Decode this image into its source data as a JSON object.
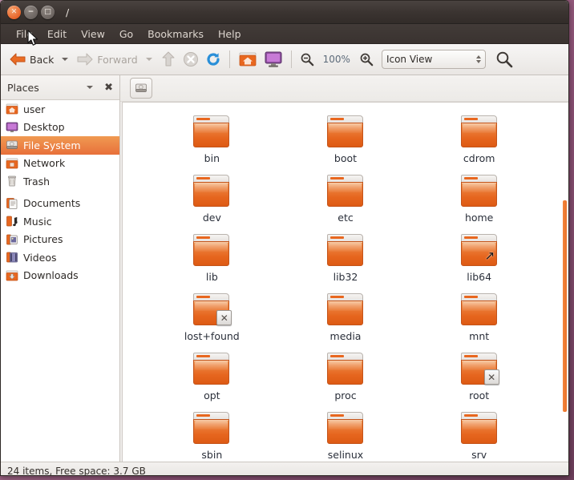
{
  "window": {
    "title": "/",
    "controls": [
      {
        "name": "close",
        "glyph": "✕"
      },
      {
        "name": "minimize",
        "glyph": "−"
      },
      {
        "name": "maximize",
        "glyph": "□"
      }
    ]
  },
  "menubar": {
    "items": [
      "File",
      "Edit",
      "View",
      "Go",
      "Bookmarks",
      "Help"
    ]
  },
  "toolbar": {
    "back_label": "Back",
    "forward_label": "Forward",
    "zoom_level": "100%",
    "view_mode": "Icon View",
    "icons": {
      "up": "up-arrow-icon",
      "stop": "stop-icon",
      "reload": "reload-icon",
      "home": "home-icon",
      "computer": "computer-icon",
      "zoom_out": "zoom-out-icon",
      "zoom_in": "zoom-in-icon",
      "search": "search-icon"
    },
    "accent_color": "#e8703a"
  },
  "sidebar": {
    "header": "Places",
    "items": [
      {
        "label": "user",
        "icon": "home-folder-icon",
        "selected": false
      },
      {
        "label": "Desktop",
        "icon": "desktop-icon",
        "selected": false
      },
      {
        "label": "File System",
        "icon": "drive-harddisk-icon",
        "selected": true
      },
      {
        "label": "Network",
        "icon": "network-icon",
        "selected": false
      },
      {
        "label": "Trash",
        "icon": "trash-icon",
        "selected": false
      },
      {
        "label": "Documents",
        "icon": "documents-icon",
        "selected": false
      },
      {
        "label": "Music",
        "icon": "music-icon",
        "selected": false
      },
      {
        "label": "Pictures",
        "icon": "pictures-icon",
        "selected": false
      },
      {
        "label": "Videos",
        "icon": "videos-icon",
        "selected": false
      },
      {
        "label": "Downloads",
        "icon": "downloads-icon",
        "selected": false
      }
    ],
    "separator_after_index": 4,
    "selected_bg": "#e8703a"
  },
  "pathbar": {
    "current_button_icon": "drive-harddisk-icon",
    "current_path": "/"
  },
  "files": [
    {
      "name": "bin",
      "emblem": null
    },
    {
      "name": "boot",
      "emblem": null
    },
    {
      "name": "cdrom",
      "emblem": null
    },
    {
      "name": "dev",
      "emblem": null
    },
    {
      "name": "etc",
      "emblem": null
    },
    {
      "name": "home",
      "emblem": null
    },
    {
      "name": "lib",
      "emblem": null
    },
    {
      "name": "lib32",
      "emblem": null
    },
    {
      "name": "lib64",
      "emblem": "symlink"
    },
    {
      "name": "lost+found",
      "emblem": "unreadable"
    },
    {
      "name": "media",
      "emblem": null
    },
    {
      "name": "mnt",
      "emblem": null
    },
    {
      "name": "opt",
      "emblem": null
    },
    {
      "name": "proc",
      "emblem": null
    },
    {
      "name": "root",
      "emblem": "unreadable"
    },
    {
      "name": "sbin",
      "emblem": null
    },
    {
      "name": "selinux",
      "emblem": null
    },
    {
      "name": "srv",
      "emblem": null
    }
  ],
  "emblem_glyphs": {
    "unreadable": "✕",
    "symlink": "↗"
  },
  "statusbar": {
    "text": "24 items, Free space: 3.7 GB"
  }
}
